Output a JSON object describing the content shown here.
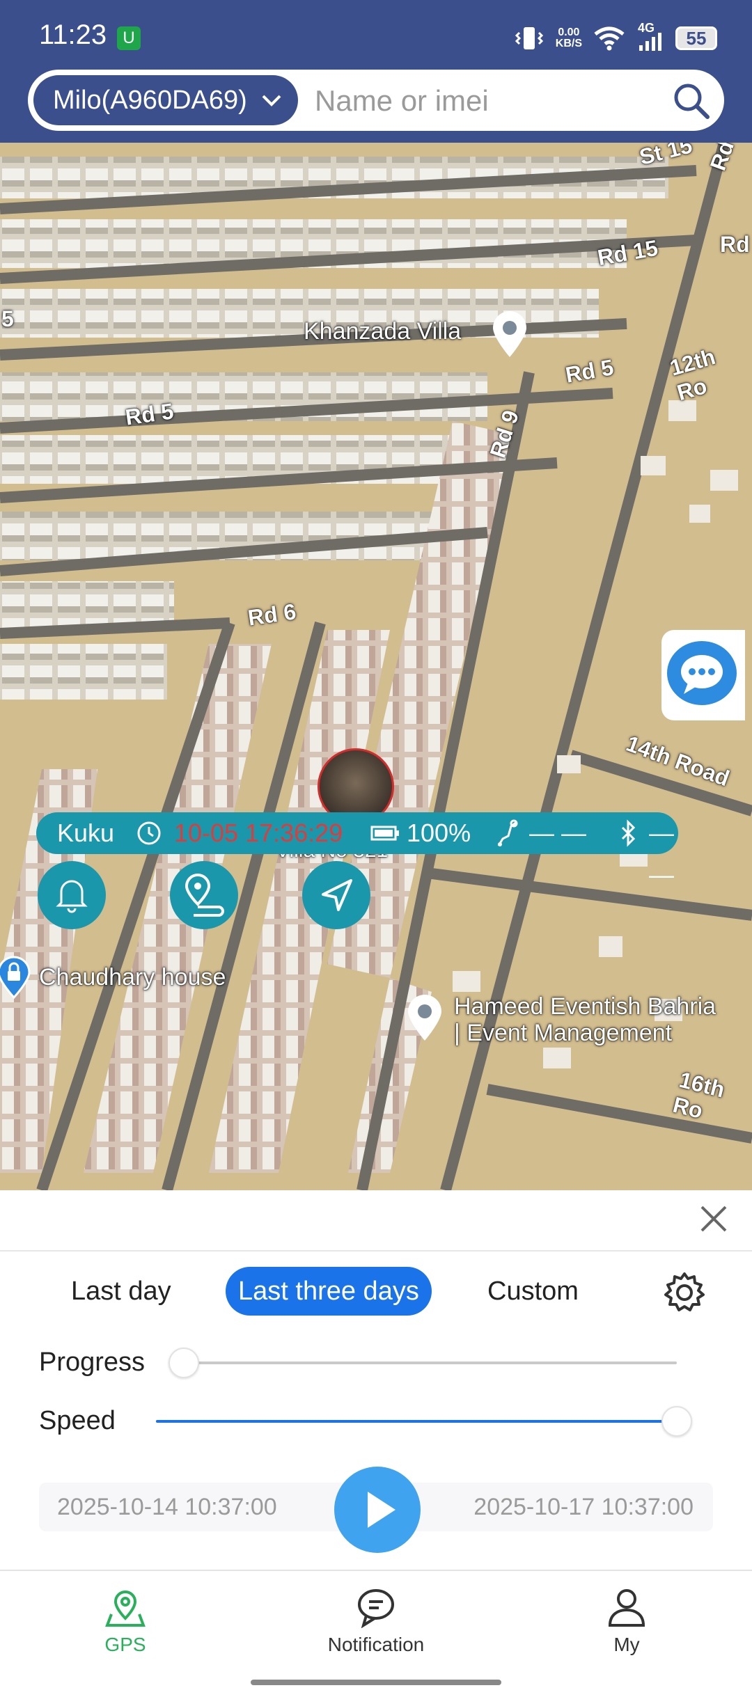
{
  "status_bar": {
    "time": "11:23",
    "app_badge": "U",
    "net_speed_value": "0.00",
    "net_speed_unit": "KB/S",
    "network_type": "4G",
    "battery": "55"
  },
  "header": {
    "device_selector": "Milo(A960DA69)",
    "search_placeholder": "Name or imei"
  },
  "map": {
    "road_labels": {
      "rd15": "Rd 15",
      "rd5_right": "Rd 5",
      "rd5_left": "Rd 5",
      "rd9": "Rd 9",
      "rd6": "Rd 6",
      "road_12th": "12th Ro",
      "road_14th": "14th Road",
      "road_16th": "16th Ro",
      "rd_edge_top": "Rd",
      "st_edge": "St 15",
      "rd_left_edge": "5"
    },
    "pois": {
      "khanzada": "Khanzada Villa",
      "chaudhary": "Chaudhary house",
      "hameed_line1": "Hameed Eventish Bahria",
      "hameed_line2": "| Event Management",
      "villa_partial": "Villa No 321"
    },
    "tracker": {
      "name": "Kuku",
      "last_update": "10-05 17:36:29",
      "battery": "100%",
      "step_value": "— —",
      "bluetooth_value": "— —"
    }
  },
  "playback_panel": {
    "tabs": [
      "Last day",
      "Last three days",
      "Custom"
    ],
    "active_tab": 1,
    "progress_label": "Progress",
    "speed_label": "Speed",
    "progress_value": 0.0,
    "speed_value": 1.0,
    "start_time": "2025-10-14 10:37:00",
    "end_time": "2025-10-17 10:37:00"
  },
  "bottom_nav": {
    "gps": "GPS",
    "notification": "Notification",
    "my": "My"
  },
  "colors": {
    "header_bg": "#3b4f8c",
    "accent_blue": "#1a73e8",
    "tracker_teal": "#1b97ac",
    "active_green": "#29b05b",
    "alert_red": "#e03b3b"
  }
}
